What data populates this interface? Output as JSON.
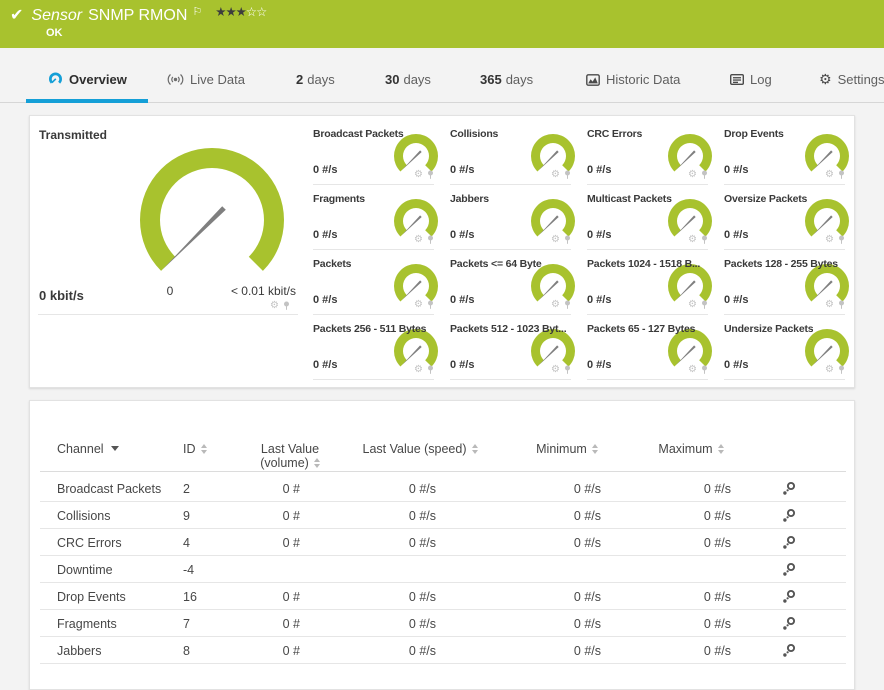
{
  "colors": {
    "green": "#a8c22e",
    "blue": "#149fd7"
  },
  "header": {
    "kind": "Sensor",
    "title": "SNMP RMON",
    "status": "OK",
    "stars_filled": 3,
    "stars_empty": 2
  },
  "tabs": {
    "overview": "Overview",
    "live": "Live Data",
    "d2_num": "2",
    "d2_label": "days",
    "d30_num": "30",
    "d30_label": "days",
    "d365_num": "365",
    "d365_label": "days",
    "historic": "Historic Data",
    "log": "Log",
    "settings": "Settings"
  },
  "main_gauge": {
    "label": "Transmitted",
    "value": "0 kbit/s",
    "scale_min": "0",
    "scale_max": "< 0.01 kbit/s"
  },
  "small_gauges": [
    {
      "label": "Broadcast Packets",
      "value": "0 #/s"
    },
    {
      "label": "Collisions",
      "value": "0 #/s"
    },
    {
      "label": "CRC Errors",
      "value": "0 #/s"
    },
    {
      "label": "Drop Events",
      "value": "0 #/s"
    },
    {
      "label": "Fragments",
      "value": "0 #/s"
    },
    {
      "label": "Jabbers",
      "value": "0 #/s"
    },
    {
      "label": "Multicast Packets",
      "value": "0 #/s"
    },
    {
      "label": "Oversize Packets",
      "value": "0 #/s"
    },
    {
      "label": "Packets",
      "value": "0 #/s"
    },
    {
      "label": "Packets <= 64 Byte",
      "value": "0 #/s"
    },
    {
      "label": "Packets 1024 - 1518 B...",
      "value": "0 #/s"
    },
    {
      "label": "Packets 128 - 255 Bytes",
      "value": "0 #/s"
    },
    {
      "label": "Packets 256 - 511 Bytes",
      "value": "0 #/s"
    },
    {
      "label": "Packets 512 - 1023 Byt...",
      "value": "0 #/s"
    },
    {
      "label": "Packets 65 - 127 Bytes",
      "value": "0 #/s"
    },
    {
      "label": "Undersize Packets",
      "value": "0 #/s"
    }
  ],
  "table": {
    "headers": {
      "channel": "Channel",
      "id": "ID",
      "volume_line1": "Last Value",
      "volume_line2": "(volume)",
      "speed": "Last Value (speed)",
      "min": "Minimum",
      "max": "Maximum"
    },
    "rows": [
      {
        "channel": "Broadcast Packets",
        "id": "2",
        "vol": "0 #",
        "speed": "0 #/s",
        "min": "0 #/s",
        "max": "0 #/s"
      },
      {
        "channel": "Collisions",
        "id": "9",
        "vol": "0 #",
        "speed": "0 #/s",
        "min": "0 #/s",
        "max": "0 #/s"
      },
      {
        "channel": "CRC Errors",
        "id": "4",
        "vol": "0 #",
        "speed": "0 #/s",
        "min": "0 #/s",
        "max": "0 #/s"
      },
      {
        "channel": "Downtime",
        "id": "-4",
        "vol": "",
        "speed": "",
        "min": "",
        "max": ""
      },
      {
        "channel": "Drop Events",
        "id": "16",
        "vol": "0 #",
        "speed": "0 #/s",
        "min": "0 #/s",
        "max": "0 #/s"
      },
      {
        "channel": "Fragments",
        "id": "7",
        "vol": "0 #",
        "speed": "0 #/s",
        "min": "0 #/s",
        "max": "0 #/s"
      },
      {
        "channel": "Jabbers",
        "id": "8",
        "vol": "0 #",
        "speed": "0 #/s",
        "min": "0 #/s",
        "max": "0 #/s"
      }
    ]
  }
}
